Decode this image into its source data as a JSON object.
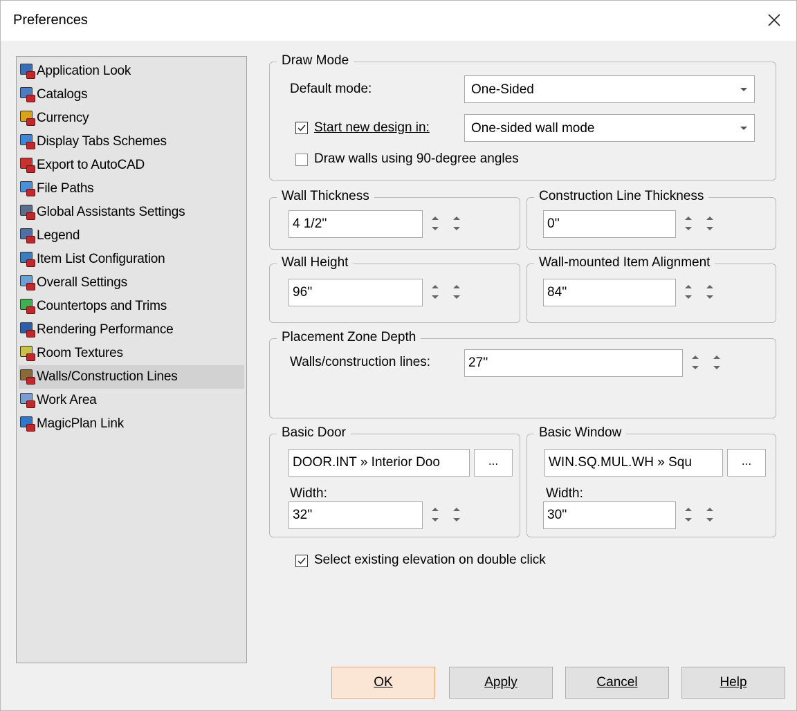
{
  "window": {
    "title": "Preferences"
  },
  "nav": {
    "items": [
      {
        "label": "Application Look",
        "icon": "application-look-icon",
        "color": "#3a6fb7"
      },
      {
        "label": "Catalogs",
        "icon": "catalogs-icon",
        "color": "#4b7cc4"
      },
      {
        "label": "Currency",
        "icon": "currency-icon",
        "color": "#d9a21b"
      },
      {
        "label": "Display Tabs Schemes",
        "icon": "display-tabs-icon",
        "color": "#3f86d6"
      },
      {
        "label": "Export to AutoCAD",
        "icon": "autocad-icon",
        "color": "#c8322f"
      },
      {
        "label": "File Paths",
        "icon": "file-paths-icon",
        "color": "#4a8fd8"
      },
      {
        "label": "Global Assistants Settings",
        "icon": "assistants-icon",
        "color": "#5a6e8c"
      },
      {
        "label": "Legend",
        "icon": "legend-icon",
        "color": "#4f6ea5"
      },
      {
        "label": "Item List Configuration",
        "icon": "item-list-icon",
        "color": "#3b7bbf"
      },
      {
        "label": "Overall Settings",
        "icon": "overall-settings-icon",
        "color": "#6aa0d8"
      },
      {
        "label": "Countertops and Trims",
        "icon": "countertops-icon",
        "color": "#3fae55"
      },
      {
        "label": "Rendering Performance",
        "icon": "rendering-icon",
        "color": "#2c5fa8"
      },
      {
        "label": "Room Textures",
        "icon": "room-textures-icon",
        "color": "#c9c24a"
      },
      {
        "label": "Walls/Construction Lines",
        "icon": "walls-icon",
        "color": "#8a6a3a"
      },
      {
        "label": "Work Area",
        "icon": "work-area-icon",
        "color": "#7a9ed0"
      },
      {
        "label": "MagicPlan Link",
        "icon": "magicplan-icon",
        "color": "#2f77c9"
      }
    ],
    "selected_index": 13
  },
  "draw_mode": {
    "title": "Draw Mode",
    "default_mode_label": "Default mode:",
    "default_mode_value": "One-Sided",
    "start_new_label": "Start new design in:",
    "start_new_checked": true,
    "start_new_value": "One-sided wall mode",
    "ninety_label": "Draw walls using 90-degree angles",
    "ninety_checked": false
  },
  "wall_thickness": {
    "title": "Wall Thickness",
    "value": "4 1/2''"
  },
  "construction_line_thickness": {
    "title": "Construction Line Thickness",
    "value": "0''"
  },
  "wall_height": {
    "title": "Wall Height",
    "value": "96''"
  },
  "wall_mounted": {
    "title": "Wall-mounted Item Alignment",
    "value": "84''"
  },
  "placement_zone": {
    "title": "Placement Zone Depth",
    "label": "Walls/construction lines:",
    "value": "27''"
  },
  "basic_door": {
    "title": "Basic Door",
    "item": "DOOR.INT » Interior Doo",
    "browse": "...",
    "width_label": "Width:",
    "width_value": "32''"
  },
  "basic_window": {
    "title": "Basic Window",
    "item": "WIN.SQ.MUL.WH » Squ",
    "browse": "...",
    "width_label": "Width:",
    "width_value": "30''"
  },
  "select_elevation": {
    "label": "Select existing elevation on double click",
    "checked": true
  },
  "buttons": {
    "ok": "OK",
    "apply": "Apply",
    "cancel": "Cancel",
    "help": "Help"
  }
}
